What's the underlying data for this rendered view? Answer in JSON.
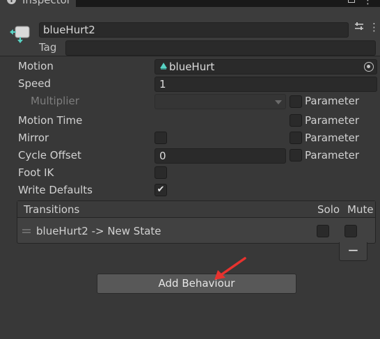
{
  "window": {
    "tab_title": "Inspector",
    "tab_icon": "info-icon",
    "accent_color": "#3a79bb"
  },
  "header": {
    "name": "blueHurt2",
    "tag_label": "Tag",
    "tag_value": "",
    "icons": [
      "animator-state-icon",
      "settings-sliders-icon",
      "more-vertical-icon"
    ]
  },
  "properties": {
    "motion": {
      "label": "Motion",
      "value": "blueHurt",
      "icon": "animation-clip-icon",
      "picker_icon": "object-picker-icon"
    },
    "speed": {
      "label": "Speed",
      "value": "1"
    },
    "multiplier": {
      "label": "Multiplier",
      "value": "",
      "parameter_label": "Parameter",
      "parameter_checked": false
    },
    "motion_time": {
      "label": "Motion Time",
      "parameter_label": "Parameter",
      "parameter_checked": false
    },
    "mirror": {
      "label": "Mirror",
      "checked": false,
      "parameter_label": "Parameter",
      "parameter_checked": false
    },
    "cycle_offset": {
      "label": "Cycle Offset",
      "value": "0",
      "parameter_label": "Parameter",
      "parameter_checked": false
    },
    "foot_ik": {
      "label": "Foot IK",
      "checked": false
    },
    "write_defaults": {
      "label": "Write Defaults",
      "checked": true,
      "check_glyph": "✔"
    }
  },
  "transitions": {
    "header_label": "Transitions",
    "solo_label": "Solo",
    "mute_label": "Mute",
    "rows": [
      {
        "label": "blueHurt2 -> New State",
        "solo": false,
        "mute": false
      }
    ],
    "remove_label": "−"
  },
  "add_behaviour_label": "Add Behaviour",
  "annotation": {
    "arrow_color": "#e8322e"
  }
}
